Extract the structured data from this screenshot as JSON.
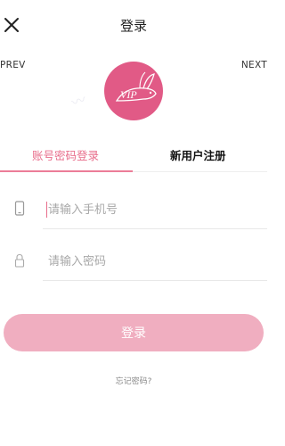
{
  "header": {
    "title": "登录"
  },
  "nav": {
    "prev_label": "PREV",
    "next_label": "NEXT"
  },
  "logo": {
    "text": "VIP"
  },
  "tabs": [
    {
      "label": "账号密码登录",
      "active": true
    },
    {
      "label": "新用户注册",
      "active": false
    }
  ],
  "form": {
    "phone_placeholder": "请输入手机号",
    "password_placeholder": "请输入密码",
    "submit_label": "登录",
    "forgot_label": "忘记密码?"
  },
  "colors": {
    "accent": "#e86d8b",
    "logo_bg": "#e15a86",
    "button_bg": "#f0aec0"
  },
  "icons": [
    "close-icon",
    "phone-icon",
    "lock-icon",
    "rabbit-logo-icon"
  ]
}
